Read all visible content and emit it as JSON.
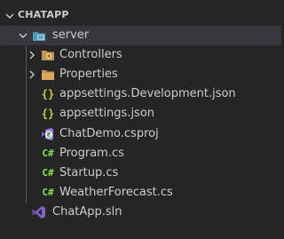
{
  "explorer": {
    "project_title": "CHATAPP",
    "items": [
      {
        "label": "server",
        "icon": "folder-server-icon"
      },
      {
        "label": "Controllers",
        "icon": "folder-controllers-icon"
      },
      {
        "label": "Properties",
        "icon": "folder-icon"
      },
      {
        "label": "appsettings.Development.json",
        "icon": "json-icon"
      },
      {
        "label": "appsettings.json",
        "icon": "json-icon"
      },
      {
        "label": "ChatDemo.csproj",
        "icon": "csproj-icon"
      },
      {
        "label": "Program.cs",
        "icon": "csharp-icon"
      },
      {
        "label": "Startup.cs",
        "icon": "csharp-icon"
      },
      {
        "label": "WeatherForecast.cs",
        "icon": "csharp-icon"
      },
      {
        "label": "ChatApp.sln",
        "icon": "visual-studio-solution-icon"
      }
    ],
    "colors": {
      "background": "#252526",
      "selected_row": "#37373d",
      "text": "#cccccc",
      "json_icon": "#cbcb41",
      "csharp_icon": "#89e051",
      "folder_icon": "#c09553",
      "server_icon": "#519aba",
      "solution_icon": "#8661c5"
    }
  }
}
